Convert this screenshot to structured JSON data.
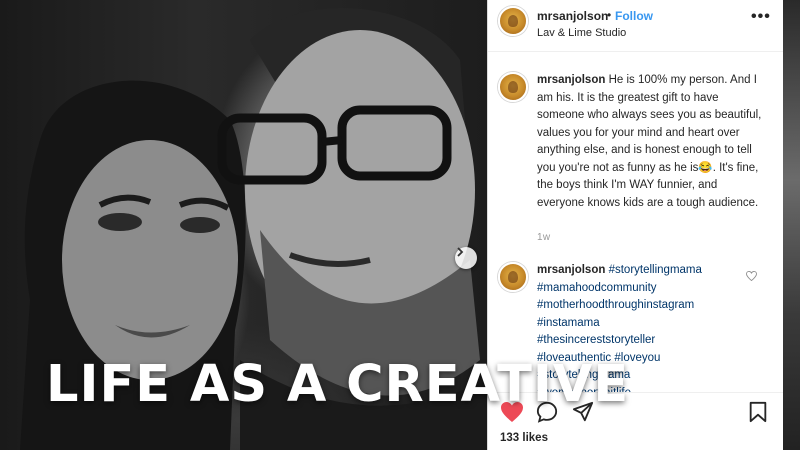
{
  "post": {
    "username": "mrsanjolson",
    "follow_separator": "•",
    "follow_label": "Follow",
    "location": "Lav & Lime Studio",
    "more_label": "•••",
    "caption": "He is 100% my person. And I am his. It is the greatest gift to have someone who always sees you as beautiful, values you for your mind and heart over anything else, and is honest enough to tell you you're not as funny as he is😂. It's fine, the boys think I'm WAY funnier, and everyone knows kids are a tough audience.",
    "time_ago": "1w",
    "hashtag_comment": {
      "username": "mrsanjolson",
      "tags": [
        "#storytellingmama",
        "#mamahoodcommunity",
        "#motherhoodthroughinstagram",
        "#instamama",
        "#thesincereststoryteller",
        "#loveauthentic",
        "#loveyou",
        "#storytellingmama",
        "#womenportraitlife"
      ]
    },
    "likes": "133 likes",
    "liked": true
  },
  "overlay": {
    "title": "LIFE AS A CREATIVE"
  },
  "colors": {
    "follow": "#3897f0",
    "like": "#ed4956",
    "hashtag": "#003569"
  },
  "icons": {
    "next": "chevron-right-icon",
    "like": "heart-icon",
    "comment": "comment-icon",
    "share": "paper-plane-icon",
    "save": "bookmark-icon"
  }
}
